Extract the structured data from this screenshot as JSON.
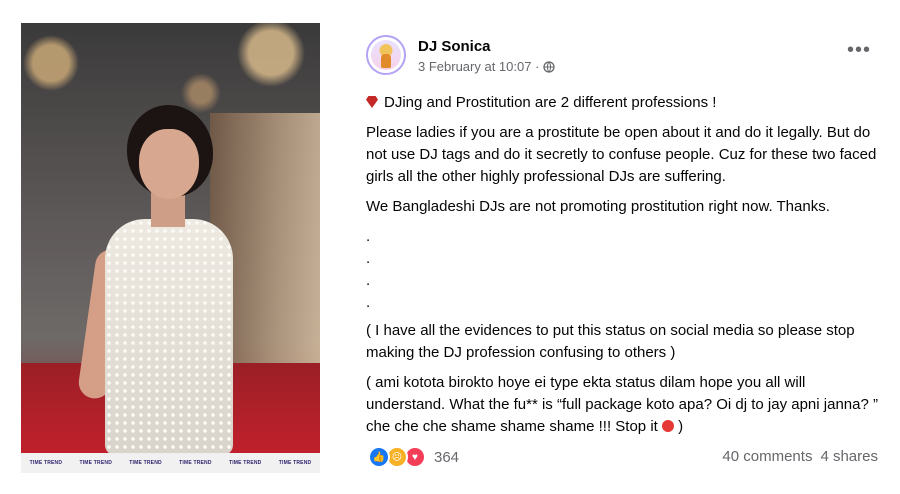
{
  "photo": {
    "logos": [
      "TIME TREND",
      "TIME TREND",
      "TIME TREND",
      "TIME TREND",
      "TIME TREND",
      "TIME TREND"
    ]
  },
  "post": {
    "author": "DJ Sonica",
    "timestamp": "3 February at 10:07 ·",
    "paragraphs": {
      "p1": "DJing and Prostitution are 2 different professions !",
      "p2": "Please ladies if you are a prostitute be open about it and do it legally. But do not use DJ tags and do it secretly to confuse people. Cuz for these two faced girls all the other highly professional DJs are suffering.",
      "p3": "We Bangladeshi DJs are not promoting prostitution right now. Thanks.",
      "dot": ".",
      "p4": "( I have all the evidences to put this status on social media so please stop making the DJ profession confusing to others )",
      "p5": "( ami kotota birokto hoye ei type ekta status dilam hope you all will understand. What the fu** is “full package koto apa? Oi dj to jay apni janna? ” che che che shame shame shame !!! Stop it",
      "p5_end": ")"
    },
    "reactions_count": "364",
    "comments": "40 comments",
    "shares": "4 shares",
    "colors": {
      "link_gray": "#65676b",
      "like_blue": "#1877f2",
      "love_red": "#f33e58",
      "sad_yellow": "#f7b125"
    },
    "icons": [
      "globe-icon",
      "more-options-icon",
      "red-gem-icon",
      "red-circle-icon",
      "like-reaction-icon",
      "sad-reaction-icon",
      "love-reaction-icon"
    ]
  }
}
